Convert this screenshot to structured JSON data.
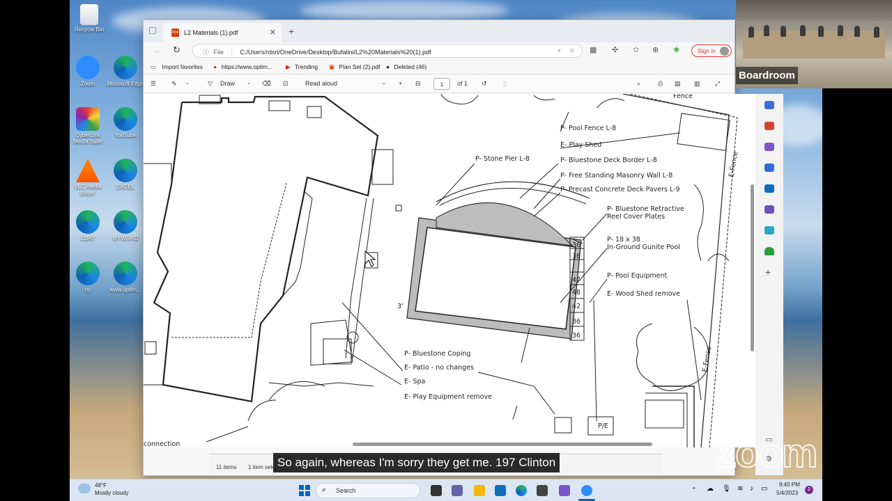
{
  "desktop": {
    "icons": [
      {
        "label": "Recycle Bin",
        "icon": "recycle-bin-icon"
      },
      {
        "label": "Zoom",
        "icon": "zoom-icon"
      },
      {
        "label": "Microsoft Edge",
        "icon": "edge-icon"
      },
      {
        "label": "CyberLink Media Suite",
        "icon": "cyberlink-icon"
      },
      {
        "label": "YouTube",
        "icon": "edge-icon"
      },
      {
        "label": "VLC media player",
        "icon": "vlc-icon"
      },
      {
        "label": "EXCEL",
        "icon": "edge-icon"
      },
      {
        "label": "EBAY",
        "icon": "edge-icon"
      },
      {
        "label": "MYWORD",
        "icon": "edge-icon"
      },
      {
        "label": "ny",
        "icon": "edge-icon"
      },
      {
        "label": "www.optim...",
        "icon": "edge-icon"
      }
    ]
  },
  "browser": {
    "tab_title": "L2 Materials (1).pdf",
    "address_prefix": "File",
    "url": "C:/Users/rdsrl/OneDrive/Desktop/Bufalini/L2%20Materials%20(1).pdf",
    "sign_in": "Sign in",
    "favorites": [
      "Import favorites",
      "https://www.optim...",
      "Trending",
      "Plan Set (2).pdf",
      "Deleted (46)"
    ],
    "pdf_toolbar": {
      "draw": "Draw",
      "read_aloud": "Read aloud",
      "page": "1",
      "of": "of 1"
    }
  },
  "plan": {
    "labels": {
      "fence_top": "Fence",
      "pool_fence": "P- Pool Fence L-8",
      "play_shed": "E- Play Shed",
      "stone_pier": "P- Stone Pier L-8",
      "deck_border": "P- Bluestone Deck Border L-8",
      "masonry_wall": "P- Free Standing Masonry Wall L-8",
      "deck_pavers": "P- Precast Concrete Deck Pavers L-9",
      "retractive_1": "P- Bluestone Retractive",
      "retractive_2": "Reel Cover Plates",
      "pool_1": "P- 18 x 38",
      "pool_2": "In-Ground Gunite Pool",
      "pool_equipment": "P- Pool Equipment",
      "wood_shed": "E- Wood Shed remove",
      "e_fence_1": "E-Fence",
      "e_fence_2": "E-Fence",
      "coping": "P- Bluestone Coping",
      "patio": "E- Patio - no changes",
      "spa": "E- Spa",
      "play_equipment": "E- Play Equipment remove",
      "pe": "P/E",
      "connection": "connection",
      "dim_3": "3'",
      "paver_36a": "36",
      "paver_36b": "36",
      "paver_47": "47",
      "paver_48": "48",
      "paver_42": "42",
      "paver_36c": "36",
      "paver_36d": "36"
    }
  },
  "explorer": {
    "items": "11 items",
    "selected": "1 item selected 201 KB"
  },
  "zoom": {
    "participant_name": "Boardroom",
    "caption": "So again, whereas I'm sorry they get me. 197 Clinton",
    "watermark": "zoom"
  },
  "taskbar": {
    "weather_temp": "48°F",
    "weather_desc": "Mostly cloudy",
    "search": "Search",
    "time": "9:40 PM",
    "date": "5/4/2023",
    "notifications": "2"
  },
  "colors": {
    "accent": "#0067c0",
    "edge_blue": "#1e88e5",
    "signin_red": "#dd3333"
  }
}
